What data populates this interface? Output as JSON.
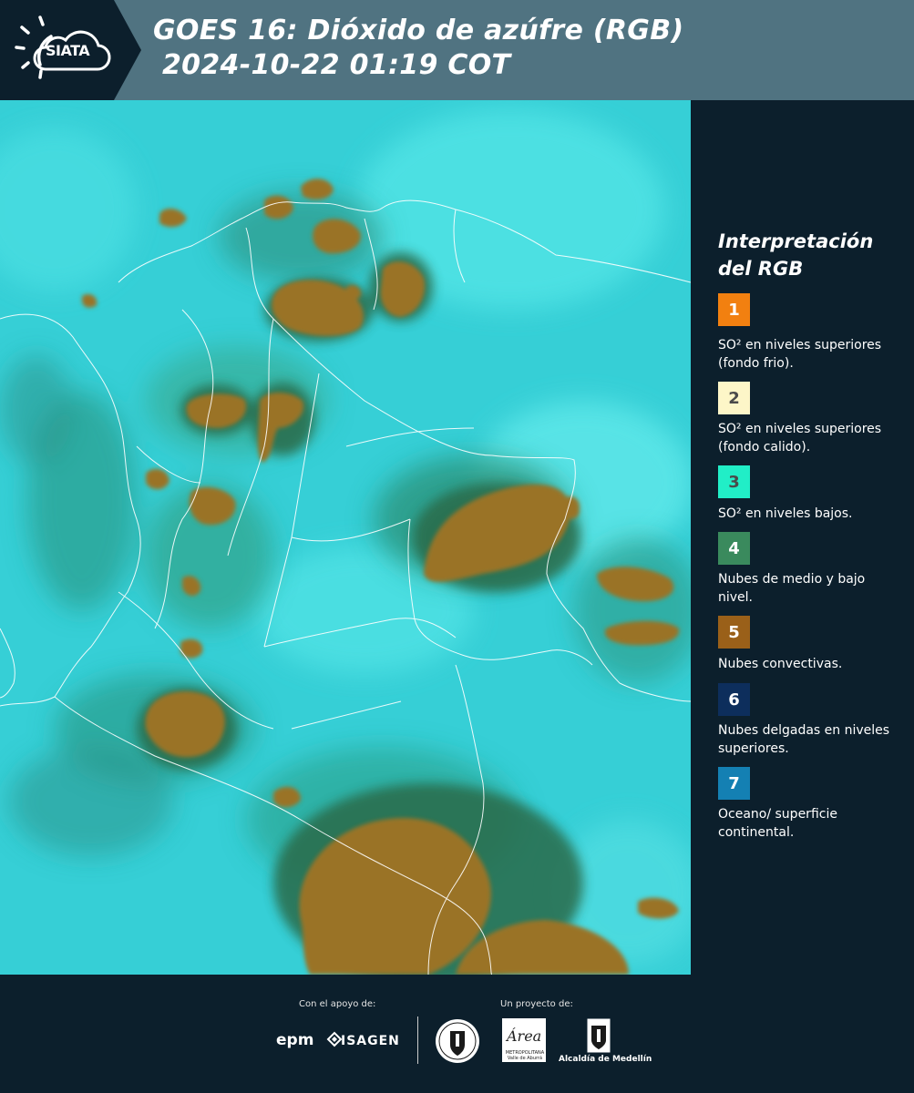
{
  "header": {
    "logo_text": "SIATA",
    "title_line1": "GOES 16: Dióxido de azúfre (RGB)",
    "title_line2": "2024-10-22 01:19 COT"
  },
  "legend": {
    "title_line1": "Interpretación",
    "title_line2": "del RGB",
    "items": [
      {
        "number": "1",
        "color": "#f28010",
        "text": "SO² en niveles superiores (fondo frio)."
      },
      {
        "number": "2",
        "color": "#fdf6c8",
        "text": "SO² en niveles superiores (fondo calido)."
      },
      {
        "number": "3",
        "color": "#21eec7",
        "text": "SO² en niveles bajos."
      },
      {
        "number": "4",
        "color": "#3a8a5d",
        "text": "Nubes de medio y bajo nivel."
      },
      {
        "number": "5",
        "color": "#9a6019",
        "text": "Nubes convectivas."
      },
      {
        "number": "6",
        "color": "#0d2e5c",
        "text": "Nubes delgadas en niveles superiores."
      },
      {
        "number": "7",
        "color": "#1480b3",
        "text": "Oceano/ superficie continental."
      }
    ]
  },
  "footer": {
    "apoyo_label": "Con el apoyo de:",
    "proyecto_label": "Un proyecto de:",
    "epm": "epm",
    "isagen": "ISAGEN",
    "area_word": "Área",
    "area_sub": "METROPOLITANA Valle de Aburrá",
    "alcaldia": "Alcaldía de Medellín"
  }
}
